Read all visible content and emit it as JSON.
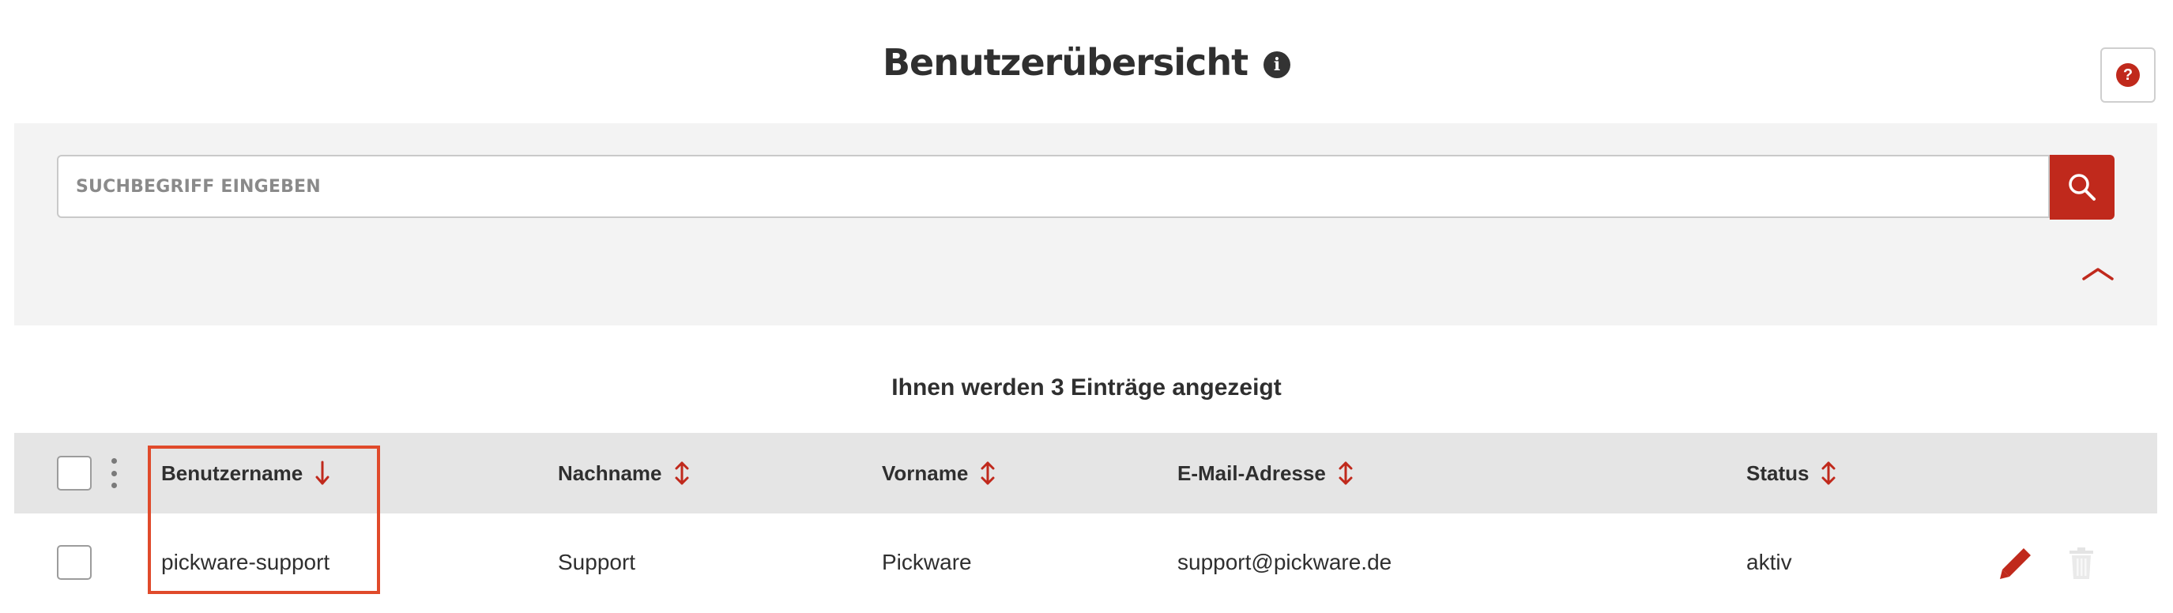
{
  "header": {
    "title": "Benutzerübersicht",
    "info_icon": "info-icon",
    "help_icon": "question-mark-icon"
  },
  "search": {
    "placeholder": "SUCHBEGRIFF EINGEBEN",
    "value": "",
    "search_icon": "magnifier-icon",
    "collapse_icon": "chevron-up-icon"
  },
  "table": {
    "count_text": "Ihnen werden 3 Einträge angezeigt",
    "columns": [
      {
        "label": "Benutzername",
        "sort": "descending"
      },
      {
        "label": "Nachname",
        "sort": "none"
      },
      {
        "label": "Vorname",
        "sort": "none"
      },
      {
        "label": "E-Mail-Adresse",
        "sort": "none"
      },
      {
        "label": "Status",
        "sort": "none"
      }
    ],
    "rows": [
      {
        "username": "pickware-support",
        "lastname": "Support",
        "firstname": "Pickware",
        "email": "support@pickware.de",
        "status": "aktiv",
        "selected": false
      }
    ],
    "row_actions": {
      "edit_icon": "pencil-icon",
      "delete_icon": "trash-icon"
    }
  },
  "colors": {
    "accent": "#c0291c",
    "highlight": "#e04a2b",
    "panel_bg": "#f3f3f3",
    "header_bg": "#e5e5e5",
    "text": "#2f2f2f"
  }
}
